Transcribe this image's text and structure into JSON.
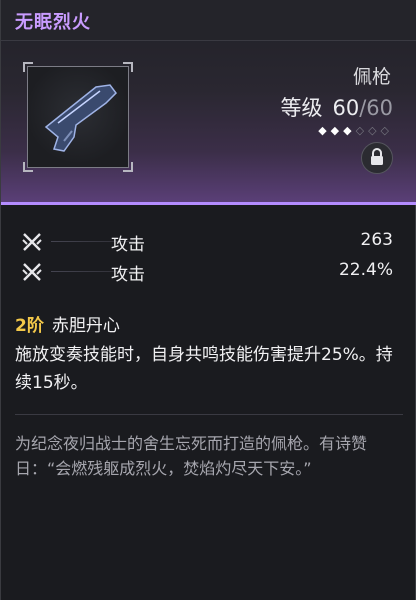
{
  "item": {
    "name": "无眠烈火",
    "type": "佩枪",
    "level_label": "等级",
    "level_current": "60",
    "level_max": "60",
    "rank_stars_filled": 3,
    "rank_stars_total": 6
  },
  "stats": [
    {
      "name": "攻击",
      "value": "263"
    },
    {
      "name": "攻击",
      "value": "22.4%"
    }
  ],
  "skill": {
    "rank": "2阶",
    "name": "赤胆丹心",
    "description": "施放变奏技能时，自身共鸣技能伤害提升25%。持续15秒。"
  },
  "lore": "为纪念夜归战士的舍生忘死而打造的佩枪。有诗赞日：“会燃残躯成烈火，焚焰灼尽天下安。”",
  "colors": {
    "title": "#c99cff",
    "accent": "#b48cff",
    "rank": "#f3c84a"
  },
  "icons": [
    "pistol-icon",
    "lock-icon",
    "crossed-swords-icon"
  ]
}
